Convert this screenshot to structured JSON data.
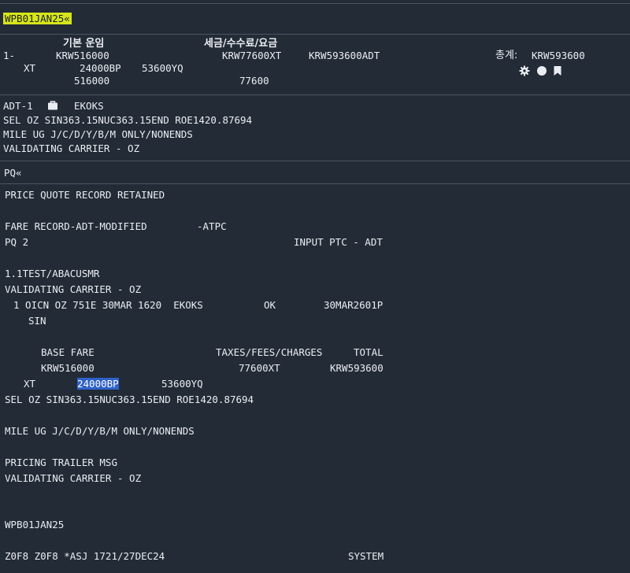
{
  "response1": {
    "command": "WPB01JAN25«",
    "fare_heading": "기본 운임",
    "tax_heading": "세금/수수료/요금",
    "line_no": "1-",
    "base_fare": "KRW516000",
    "taxes": "KRW77600XT",
    "total_adt": "KRW593600ADT",
    "grand_total_label": "총계:",
    "grand_total": "KRW593600",
    "xt_label": "XT",
    "xt_bp": "24000BP",
    "xt_yq": "53600YQ",
    "base_sum": "516000",
    "tax_sum": "77600",
    "icons": [
      "gear-icon",
      "circle-icon",
      "bookmark-icon"
    ]
  },
  "details1": {
    "ptc": "ADT-1",
    "baggage_icon": "baggage-icon",
    "fare_basis": "EKOKS",
    "line1": "SEL OZ SIN363.15NUC363.15END ROE1420.87694",
    "line2": "MILE UG J/C/D/Y/B/M ONLY/NONENDS",
    "line3": "VALIDATING CARRIER - OZ"
  },
  "response2": {
    "command": "PQ«",
    "line_retained": "PRICE QUOTE RECORD RETAINED",
    "line_record": "FARE RECORD-ADT-MODIFIED",
    "line_atpc": "-ATPC",
    "line_pq": "PQ 2",
    "line_input_ptc": "INPUT PTC - ADT",
    "line_name": "1.1TEST/ABACUSMR",
    "line_validating": "VALIDATING CARRIER - OZ",
    "segment": "1 OICN OZ 751E 30MAR 1620  EKOKS",
    "segment_status": "OK",
    "segment_nvb": "30MAR2601P",
    "segment_dest": "SIN",
    "hdr_base": "BASE FARE",
    "hdr_taxes": "TAXES/FEES/CHARGES",
    "hdr_total": "TOTAL",
    "val_base": "KRW516000",
    "val_taxes": "77600XT",
    "val_total": "KRW593600",
    "xt_label": "XT",
    "xt_bp": "24000BP",
    "xt_yq": "53600YQ",
    "fare_calc": "SEL OZ SIN363.15NUC363.15END ROE1420.87694",
    "mile_line": "MILE UG J/C/D/Y/B/M ONLY/NONENDS",
    "trailer": "PRICING TRAILER MSG",
    "trailer_validating": "VALIDATING CARRIER - OZ",
    "repeat_cmd": "WPB01JAN25",
    "footer_left": "Z0F8 Z0F8 *ASJ 1721/27DEC24",
    "footer_right": "SYSTEM"
  }
}
